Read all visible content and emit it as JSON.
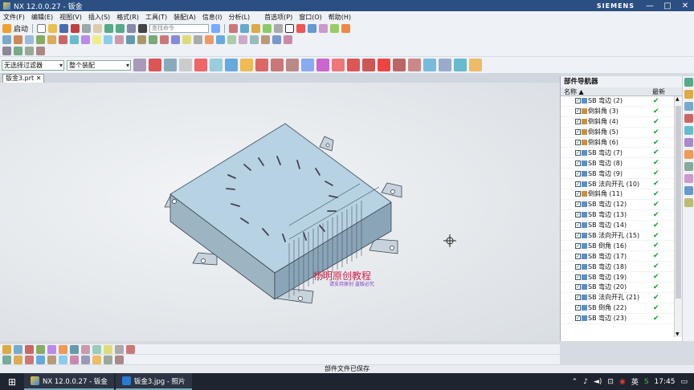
{
  "titlebar": {
    "title": "NX 12.0.0.27 - 钣金",
    "brand": "SIEMENS",
    "min": "—",
    "max": "□",
    "close": "✕"
  },
  "menu": {
    "items": [
      "文件(F)",
      "编辑(E)",
      "视图(V)",
      "插入(S)",
      "格式(R)",
      "工具(T)",
      "装配(A)",
      "信息(I)",
      "分析(L)",
      "首选项(P)",
      "窗口(O)",
      "帮助(H)"
    ]
  },
  "toolbar": {
    "start_label": "启动",
    "search_placeholder": "查找命令"
  },
  "selection": {
    "filter": "无选择过滤器",
    "scope": "整个装配"
  },
  "tab": {
    "name": "钣金3.prt",
    "close": "✕"
  },
  "viewport": {
    "watermark_title": "杨明原创教程",
    "watermark_sub": "请支持原创 盗版必究"
  },
  "navigator": {
    "title": "部件导航器",
    "col_name": "名称",
    "col_latest": "最新",
    "sort_arrow": "▲",
    "rows": [
      {
        "label": "SB 弯边 (2)",
        "icon": "flange"
      },
      {
        "label": "倒斜角 (3)",
        "icon": "chamfer"
      },
      {
        "label": "倒斜角 (4)",
        "icon": "chamfer"
      },
      {
        "label": "倒斜角 (5)",
        "icon": "chamfer"
      },
      {
        "label": "倒斜角 (6)",
        "icon": "chamfer"
      },
      {
        "label": "SB 弯边 (7)",
        "icon": "flange"
      },
      {
        "label": "SB 弯边 (8)",
        "icon": "flange"
      },
      {
        "label": "SB 弯边 (9)",
        "icon": "flange"
      },
      {
        "label": "SB 法向开孔 (10)",
        "icon": "cutout"
      },
      {
        "label": "倒斜角 (11)",
        "icon": "chamfer"
      },
      {
        "label": "SB 弯边 (12)",
        "icon": "flange"
      },
      {
        "label": "SB 弯边 (13)",
        "icon": "flange"
      },
      {
        "label": "SB 弯边 (14)",
        "icon": "flange"
      },
      {
        "label": "SB 法向开孔 (15)",
        "icon": "cutout"
      },
      {
        "label": "SB 倒角 (16)",
        "icon": "flange"
      },
      {
        "label": "SB 弯边 (17)",
        "icon": "flange"
      },
      {
        "label": "SB 弯边 (18)",
        "icon": "flange"
      },
      {
        "label": "SB 弯边 (19)",
        "icon": "flange"
      },
      {
        "label": "SB 弯边 (20)",
        "icon": "flange"
      },
      {
        "label": "SB 法向开孔 (21)",
        "icon": "cutout"
      },
      {
        "label": "SB 倒角 (22)",
        "icon": "flange"
      },
      {
        "label": "SB 弯边 (23)",
        "icon": "flange"
      }
    ],
    "latest_mark": "✔",
    "scroll_up": "▲",
    "scroll_down": "▼"
  },
  "status": {
    "message": "部件文件已保存"
  },
  "taskbar": {
    "windows_icon": "⊞",
    "app1": "NX 12.0.0.27 - 钣金",
    "app2": "钣金3.jpg - 照片",
    "ime": "英",
    "time": "17:45"
  },
  "colors": {
    "accent": "#2b4f81",
    "part_top": "#b8d4e4",
    "part_side": "#9cb8cc",
    "check": "#09a01a"
  }
}
